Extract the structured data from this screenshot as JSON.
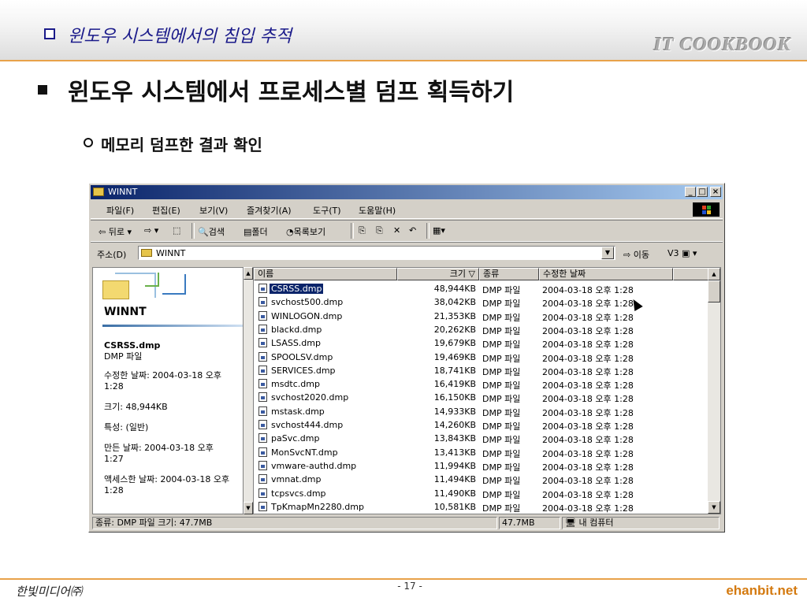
{
  "slide": {
    "header_title": "윈도우 시스템에서의 침입 추적",
    "brand": "IT COOKBOOK",
    "main_title": "윈도우 시스템에서 프로세스별 덤프 획득하기",
    "sub_title": "메모리 덤프한 결과 확인",
    "footer_left": "한빛미디어㈜",
    "footer_page": "- 17 -",
    "footer_right": "ehanbit.net"
  },
  "window": {
    "title": "WINNT",
    "buttons": {
      "minimize": "_",
      "maximize": "□",
      "close": "×"
    },
    "menu": [
      "파일(F)",
      "편집(E)",
      "보기(V)",
      "즐겨찾기(A)",
      "도구(T)",
      "도움말(H)"
    ],
    "toolbar": {
      "back": "⇦ 뒤로 ▾",
      "forward": "⇨ ▾",
      "up": "⬚",
      "search": "검색",
      "folders": "폴더",
      "history": "목록보기",
      "move": "⎘",
      "copy": "⎘",
      "delete": "✕",
      "undo": "↶",
      "views": "▦▾"
    },
    "address": {
      "label": "주소(D)",
      "value": "WINNT",
      "go": "이동",
      "v3": "V3"
    },
    "left_pane": {
      "heading": "WINNT",
      "file_name": "CSRSS.dmp",
      "file_type": "DMP 파일",
      "modified_line1": "수정한 날짜: 2004-03-18 오후",
      "modified_line2": "1:28",
      "size": "크기: 48,944KB",
      "attributes": "특성: (일반)",
      "created_line1": "만든 날짜: 2004-03-18 오후",
      "created_line2": "1:27",
      "accessed_line1": "액세스한 날짜: 2004-03-18 오후",
      "accessed_line2": "1:28"
    },
    "columns": [
      "이름",
      "크기 ▽",
      "종류",
      "수정한 날짜"
    ],
    "files": [
      {
        "name": "CSRSS.dmp",
        "size": "48,944KB",
        "type": "DMP 파일",
        "date": "2004-03-18 오후 1:28"
      },
      {
        "name": "svchost500.dmp",
        "size": "38,042KB",
        "type": "DMP 파일",
        "date": "2004-03-18 오후 1:28"
      },
      {
        "name": "WINLOGON.dmp",
        "size": "21,353KB",
        "type": "DMP 파일",
        "date": "2004-03-18 오후 1:28"
      },
      {
        "name": "blackd.dmp",
        "size": "20,262KB",
        "type": "DMP 파일",
        "date": "2004-03-18 오후 1:28"
      },
      {
        "name": "LSASS.dmp",
        "size": "19,679KB",
        "type": "DMP 파일",
        "date": "2004-03-18 오후 1:28"
      },
      {
        "name": "SPOOLSV.dmp",
        "size": "19,469KB",
        "type": "DMP 파일",
        "date": "2004-03-18 오후 1:28"
      },
      {
        "name": "SERVICES.dmp",
        "size": "18,741KB",
        "type": "DMP 파일",
        "date": "2004-03-18 오후 1:28"
      },
      {
        "name": "msdtc.dmp",
        "size": "16,419KB",
        "type": "DMP 파일",
        "date": "2004-03-18 오후 1:28"
      },
      {
        "name": "svchost2020.dmp",
        "size": "16,150KB",
        "type": "DMP 파일",
        "date": "2004-03-18 오후 1:28"
      },
      {
        "name": "mstask.dmp",
        "size": "14,933KB",
        "type": "DMP 파일",
        "date": "2004-03-18 오후 1:28"
      },
      {
        "name": "svchost444.dmp",
        "size": "14,260KB",
        "type": "DMP 파일",
        "date": "2004-03-18 오후 1:28"
      },
      {
        "name": "paSvc.dmp",
        "size": "13,843KB",
        "type": "DMP 파일",
        "date": "2004-03-18 오후 1:28"
      },
      {
        "name": "MonSvcNT.dmp",
        "size": "13,413KB",
        "type": "DMP 파일",
        "date": "2004-03-18 오후 1:28"
      },
      {
        "name": "vmware-authd.dmp",
        "size": "11,994KB",
        "type": "DMP 파일",
        "date": "2004-03-18 오후 1:28"
      },
      {
        "name": "vmnat.dmp",
        "size": "11,494KB",
        "type": "DMP 파일",
        "date": "2004-03-18 오후 1:28"
      },
      {
        "name": "tcpsvcs.dmp",
        "size": "11,490KB",
        "type": "DMP 파일",
        "date": "2004-03-18 오후 1:28"
      },
      {
        "name": "TpKmapMn2280.dmp",
        "size": "10,581KB",
        "type": "DMP 파일",
        "date": "2004-03-18 오후 1:28"
      }
    ],
    "status": {
      "left": "종류: DMP 파일 크기: 47.7MB",
      "size": "47.7MB",
      "zone": "내 컴퓨터"
    }
  },
  "colors": {
    "accent_orange": "#e8a24a",
    "title_blue": "#1a1a8a",
    "selection": "#0a246a",
    "footer_brand": "#d47a10"
  }
}
